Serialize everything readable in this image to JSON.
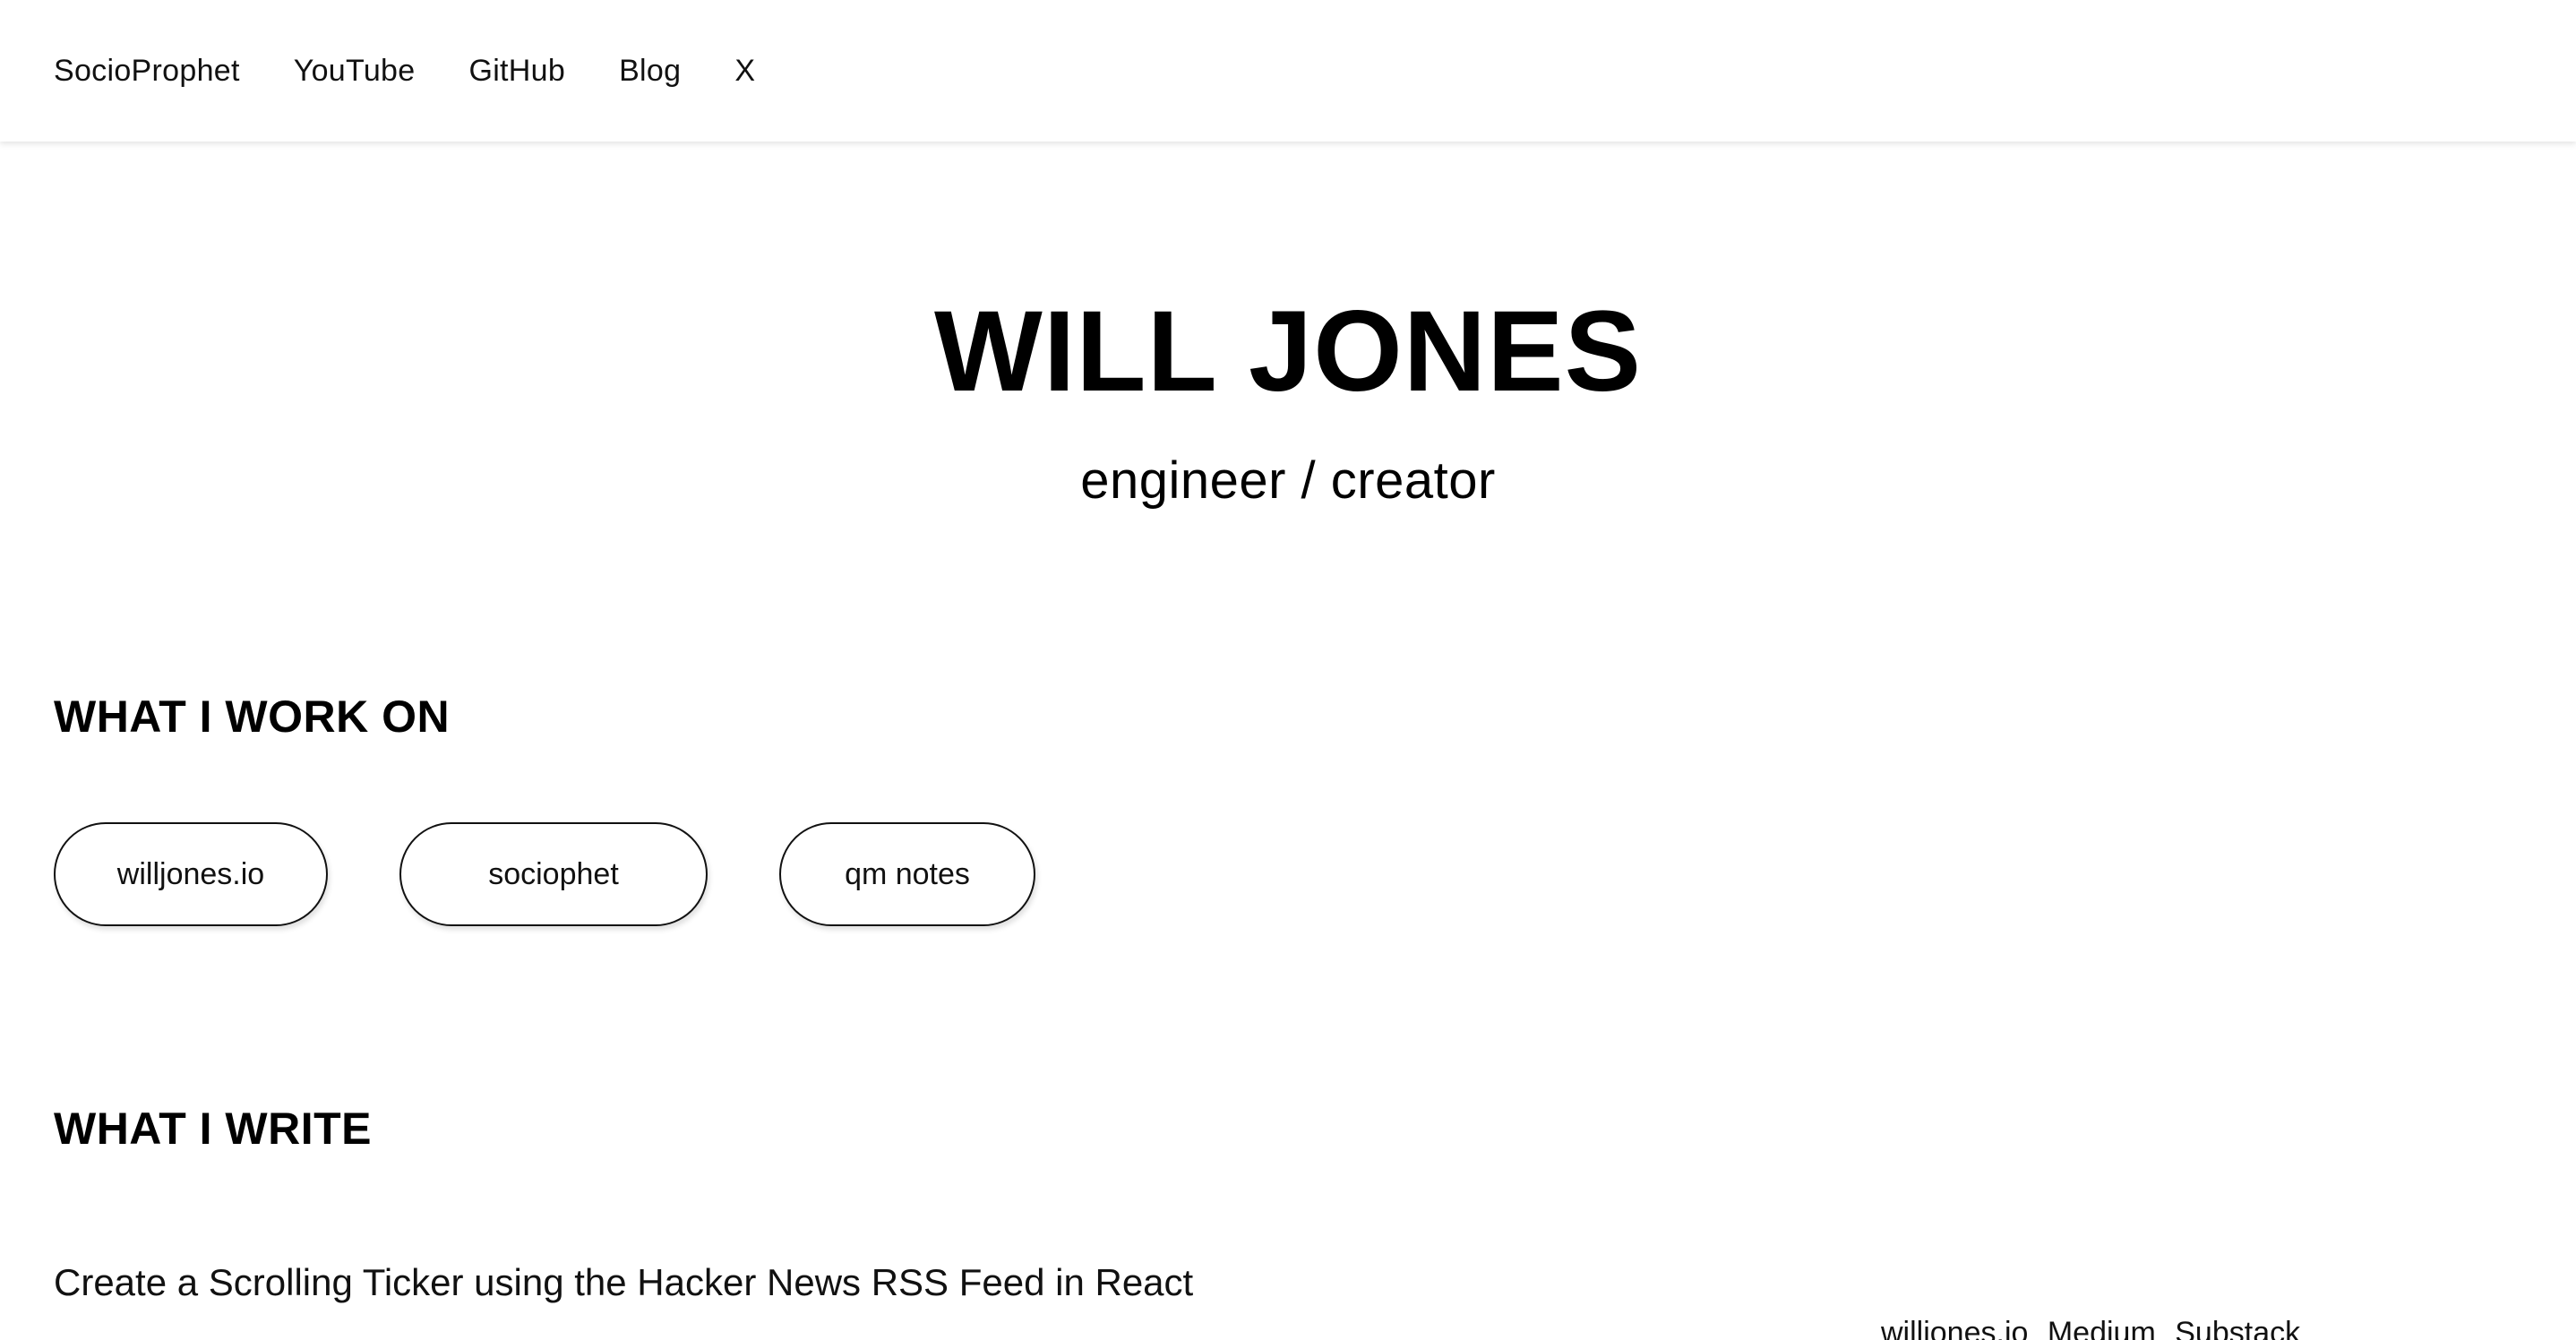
{
  "nav": {
    "items": [
      {
        "label": "SocioProphet"
      },
      {
        "label": "YouTube"
      },
      {
        "label": "GitHub"
      },
      {
        "label": "Blog"
      },
      {
        "label": "X"
      }
    ]
  },
  "hero": {
    "name": "WILL JONES",
    "subtitle": "engineer / creator"
  },
  "work": {
    "heading": "WHAT I WORK ON",
    "projects": [
      {
        "label": "willjones.io"
      },
      {
        "label": "sociophet"
      },
      {
        "label": "qm notes"
      }
    ]
  },
  "write": {
    "heading": "WHAT I WRITE",
    "articles": [
      {
        "title": "Create a Scrolling Ticker using the Hacker News RSS Feed in React",
        "links": [
          "willjones.io",
          "Medium",
          "Substack"
        ]
      }
    ]
  }
}
